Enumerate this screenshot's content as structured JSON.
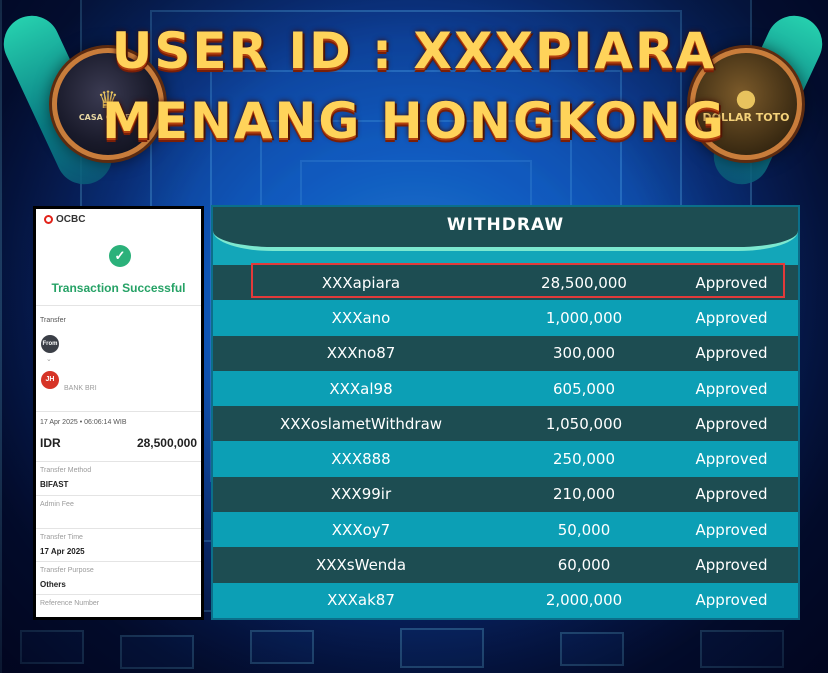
{
  "header": {
    "line1": "USER ID : XXXPIARA",
    "line2": "MENANG HONGKONG",
    "left_emblem": "CASA GADEN",
    "right_emblem": "DOLLAR TOTO"
  },
  "receipt": {
    "bank": "OCBC",
    "status": "Transaction Successful",
    "section_label": "Transfer",
    "from_badge": "From",
    "to_badge": "JH",
    "to_bank": "BANK BRI",
    "datetime": "17 Apr 2025 • 06:06:14 WIB",
    "currency": "IDR",
    "amount": "28,500,000",
    "fields": [
      {
        "label": "Transfer Method",
        "value": "BIFAST"
      },
      {
        "label": "Admin Fee",
        "value": ""
      },
      {
        "label": "Transfer Time",
        "value": "17 Apr 2025"
      },
      {
        "label": "Transfer Purpose",
        "value": "Others"
      },
      {
        "label": "Reference Number",
        "value": ""
      }
    ],
    "colors": {
      "success": "#26a266",
      "bank": "#e2231a"
    }
  },
  "withdraw": {
    "title": "WITHDRAW",
    "rows": [
      {
        "user": "XXXapiara",
        "amount": "28,500,000",
        "status": "Approved"
      },
      {
        "user": "XXXano",
        "amount": "1,000,000",
        "status": "Approved"
      },
      {
        "user": "XXXno87",
        "amount": "300,000",
        "status": "Approved"
      },
      {
        "user": "XXXal98",
        "amount": "605,000",
        "status": "Approved"
      },
      {
        "user": "XXXoslametWithdraw",
        "amount": "1,050,000",
        "status": "Approved"
      },
      {
        "user": "XXX888",
        "amount": "250,000",
        "status": "Approved"
      },
      {
        "user": "XXX99ir",
        "amount": "210,000",
        "status": "Approved"
      },
      {
        "user": "XXXoy7",
        "amount": "50,000",
        "status": "Approved"
      },
      {
        "user": "XXXsWenda",
        "amount": "60,000",
        "status": "Approved"
      },
      {
        "user": "XXXak87",
        "amount": "2,000,000",
        "status": "Approved"
      }
    ],
    "colors": {
      "dark_row": "#1d4d52",
      "light_row": "#0c9fb5",
      "highlight": "#e23a3a"
    }
  }
}
